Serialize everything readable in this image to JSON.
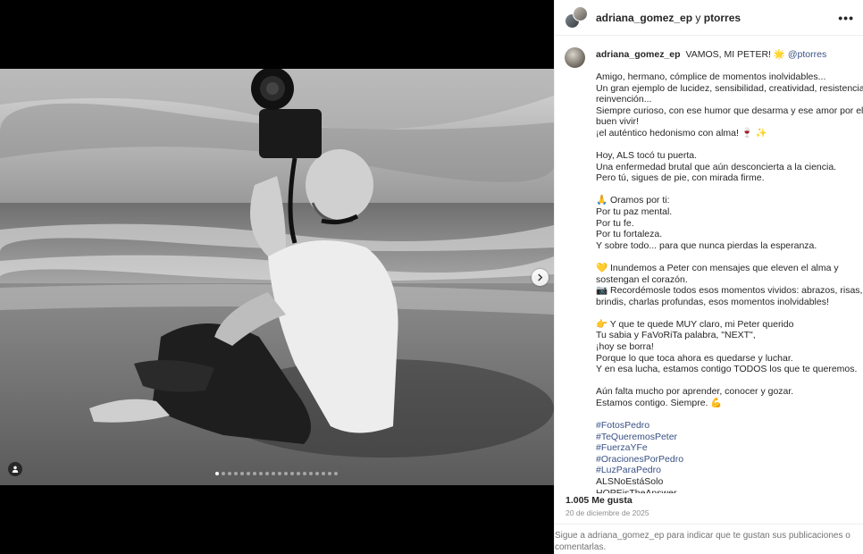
{
  "header": {
    "user1": "adriana_gomez_ep",
    "connector": "y",
    "user2": "ptorres"
  },
  "caption": {
    "username": "adriana_gomez_ep",
    "first_line_text": "VAMOS, MI PETER! 🌟",
    "first_line_mention": "@ptorres",
    "paragraphs": [
      [
        "Amigo, hermano, cómplice de momentos inolvidables...",
        "Un gran ejemplo de lucidez, sensibilidad, creatividad, resistencia,",
        "reinvención...",
        "Siempre curioso, con ese humor que desarma y ese amor por el",
        "buen vivir!",
        "¡el auténtico hedonismo con alma! 🍷 ✨"
      ],
      [
        "Hoy, ALS tocó tu puerta.",
        "Una enfermedad brutal que aún desconcierta a la ciencia.",
        "Pero tú, sigues de pie, con mirada firme."
      ],
      [
        "🙏 Oramos por ti:",
        "Por tu paz mental.",
        "Por tu fe.",
        "Por tu fortaleza.",
        "Y sobre todo... para que nunca pierdas la esperanza."
      ],
      [
        "💛 Inundemos a Peter con mensajes que eleven el alma y",
        "sostengan el corazón.",
        "📷 Recordémosle todos esos momentos vividos: abrazos, risas,",
        "brindis, charlas profundas, esos momentos inolvidables!"
      ],
      [
        "👉 Y que te quede MUY claro, mi Peter querido",
        "Tu sabia y FaVoRiTa palabra, \"NEXT\",",
        "¡hoy se borra!",
        "Porque lo que toca ahora es quedarse y luchar.",
        "Y en esa lucha, estamos contigo TODOS los que te queremos."
      ],
      [
        "Aún falta mucho por aprender, conocer y gozar.",
        "Estamos contigo. Siempre. 💪"
      ]
    ],
    "hashtags": [
      "#FotosPedro",
      "#TeQueremosPeter",
      "#FuerzaYFe",
      "#OracionesPorPedro",
      "#LuzParaPedro"
    ],
    "trailing_lines": [
      "ALSNoEstáSolo",
      "HOPEisTheAnswer"
    ]
  },
  "likes_text": "1.005 Me gusta",
  "date_text": "20 de diciembre de 2025",
  "login_prompt": "Sigue a adriana_gomez_ep para indicar que te gustan sus publicaciones o comentarlas.",
  "carousel": {
    "total_slides": 20,
    "active_index": 0
  },
  "icons": {
    "next": "chevron-right-icon",
    "tag": "user-tag-icon",
    "more": "more-options-icon"
  },
  "colors": {
    "link": "#385185",
    "muted": "#8e8e8e",
    "media_bg": "#000000"
  }
}
